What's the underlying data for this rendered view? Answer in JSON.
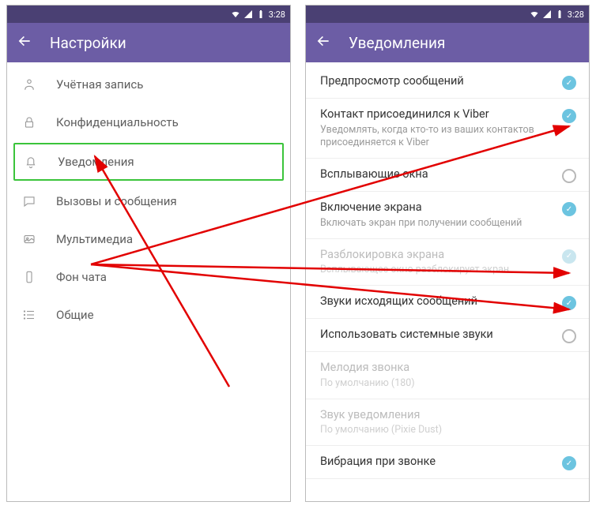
{
  "statusbar": {
    "time": "3:28"
  },
  "left_screen": {
    "title": "Настройки",
    "items": [
      {
        "label": "Учётная запись"
      },
      {
        "label": "Конфиденциальность"
      },
      {
        "label": "Уведомления"
      },
      {
        "label": "Вызовы и сообщения"
      },
      {
        "label": "Мультимедиа"
      },
      {
        "label": "Фон чата"
      },
      {
        "label": "Общие"
      }
    ]
  },
  "right_screen": {
    "title": "Уведомления",
    "settings": [
      {
        "title": "Предпросмотр сообщений",
        "sub": "",
        "state": "on",
        "disabled": false
      },
      {
        "title": "Контакт присоединился к Viber",
        "sub": "Уведомлять, когда кто-то из ваших контактов присоединяется к Viber",
        "state": "on",
        "disabled": false
      },
      {
        "title": "Всплывающие окна",
        "sub": "",
        "state": "off",
        "disabled": false
      },
      {
        "title": "Включение экрана",
        "sub": "Включать экран при получении сообщений",
        "state": "on",
        "disabled": false
      },
      {
        "title": "Разблокировка экрана",
        "sub": "Всплывающее окно разблокирует экран",
        "state": "disabled-on",
        "disabled": true
      },
      {
        "title": "Звуки исходящих сообщений",
        "sub": "",
        "state": "on",
        "disabled": false
      },
      {
        "title": "Использовать системные звуки",
        "sub": "",
        "state": "off",
        "disabled": false
      },
      {
        "title": "Мелодия звонка",
        "sub": "По умолчанию (180)",
        "state": "",
        "disabled": true
      },
      {
        "title": "Звук уведомления",
        "sub": "По умолчанию (Pixie Dust)",
        "state": "",
        "disabled": true
      },
      {
        "title": "Вибрация при звонке",
        "sub": "",
        "state": "on",
        "disabled": false
      }
    ]
  }
}
